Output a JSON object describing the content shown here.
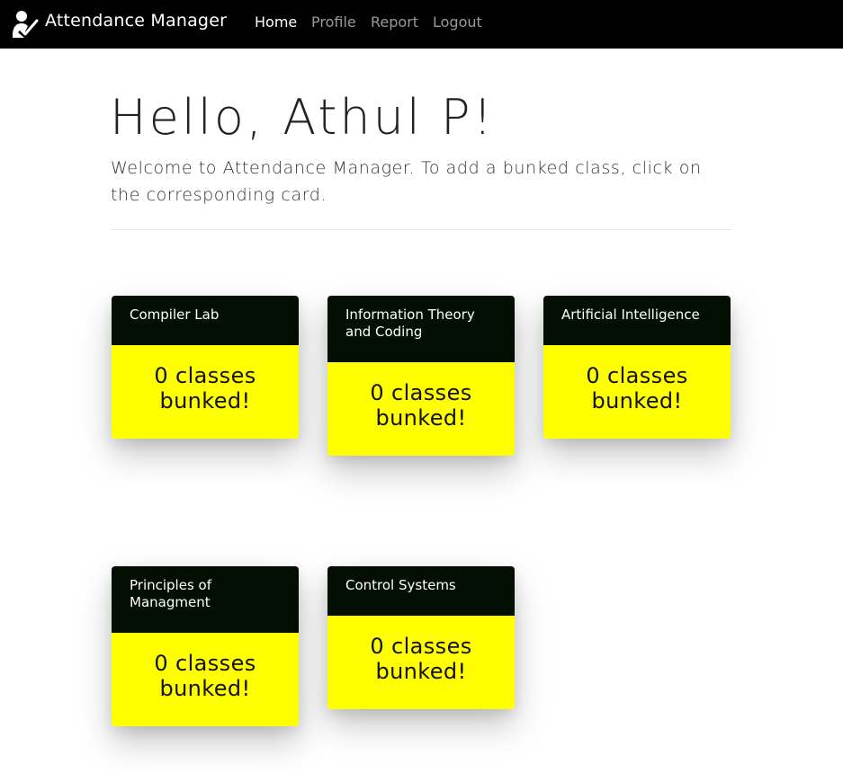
{
  "navbar": {
    "brand": "Attendance Manager",
    "links": [
      {
        "label": "Home",
        "active": true
      },
      {
        "label": "Profile",
        "active": false
      },
      {
        "label": "Report",
        "active": false
      },
      {
        "label": "Logout",
        "active": false
      }
    ]
  },
  "hero": {
    "title": "Hello, Athul P!",
    "lead": "Welcome to Attendance Manager. To add a bunked class, click on the corresponding card."
  },
  "cards": [
    {
      "subject": "Compiler Lab",
      "status": "0 classes bunked!"
    },
    {
      "subject": "Information Theory and Coding",
      "status": "0 classes bunked!"
    },
    {
      "subject": "Artificial Intelligence",
      "status": "0 classes bunked!"
    },
    {
      "subject": "Principles of Managment",
      "status": "0 classes bunked!"
    },
    {
      "subject": "Control Systems",
      "status": "0 classes bunked!"
    }
  ],
  "colors": {
    "navbar_bg": "#000000",
    "card_header_bg": "#020f02",
    "card_body_bg": "#ffff00"
  }
}
